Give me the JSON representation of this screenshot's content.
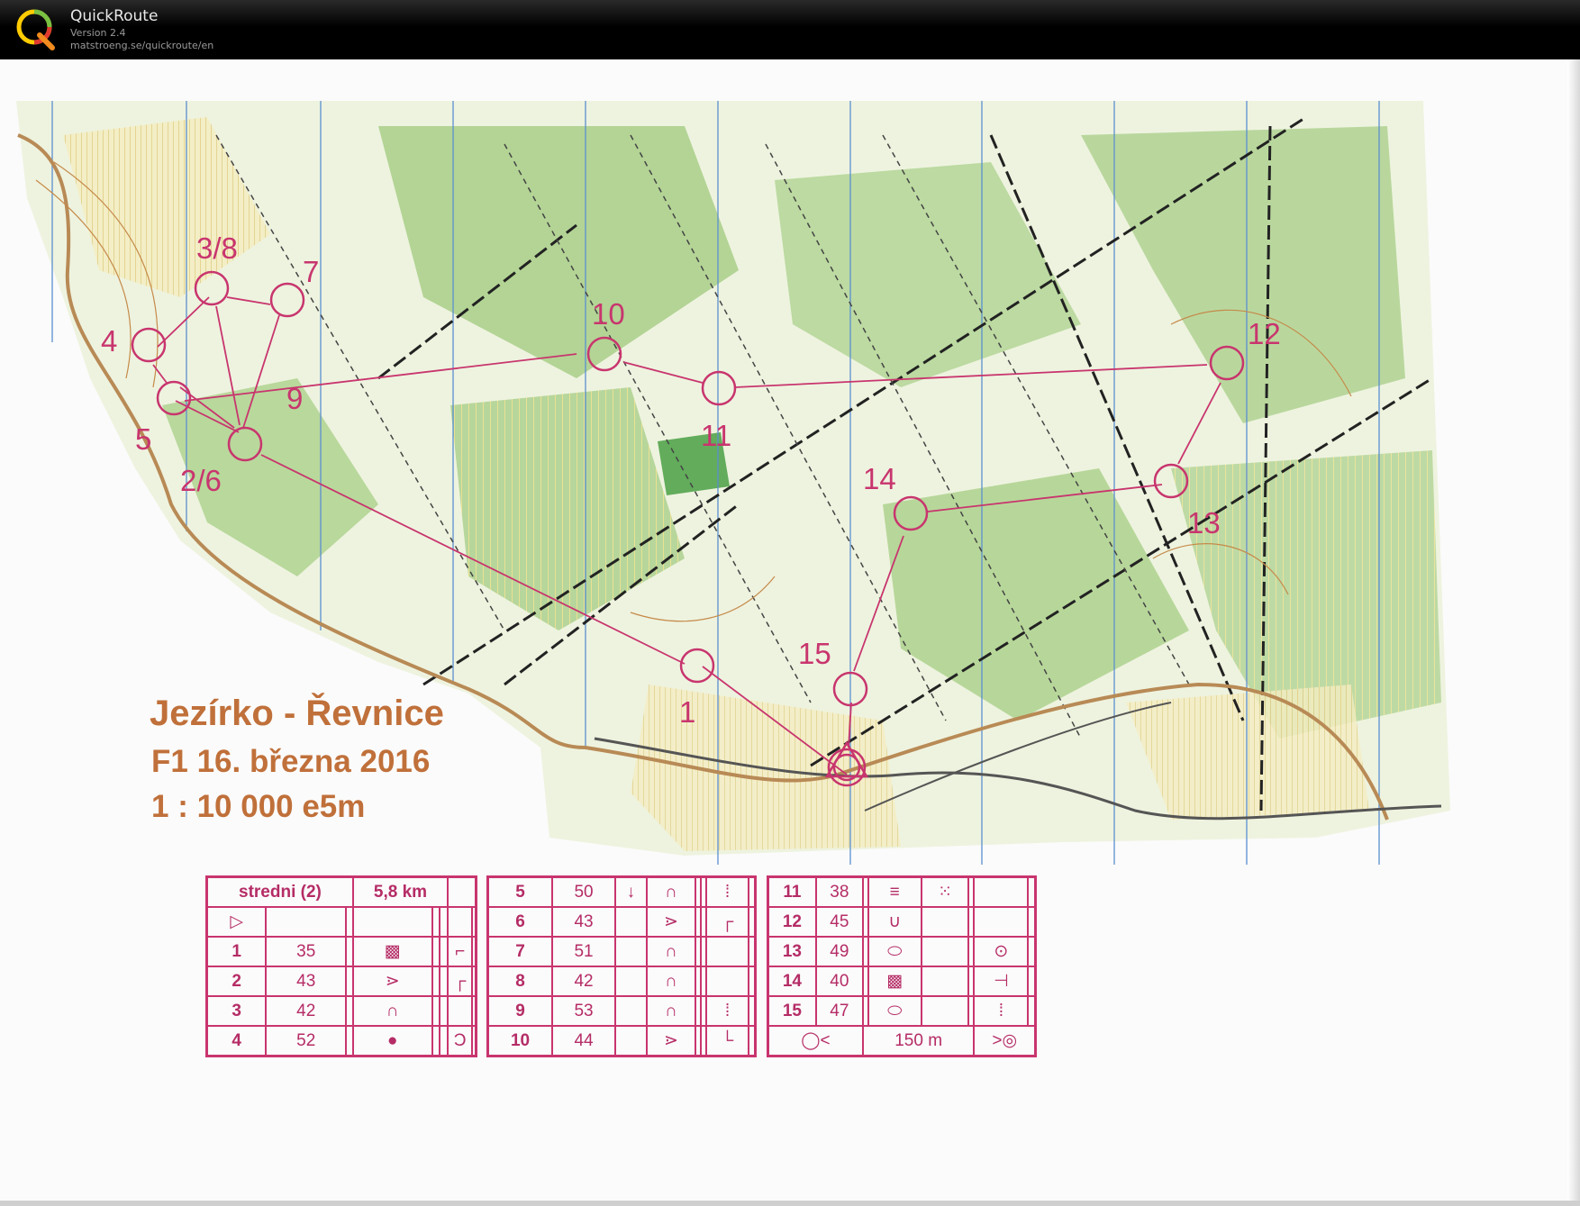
{
  "app": {
    "name": "QuickRoute",
    "version": "Version 2.4",
    "url": "matstroeng.se/quickroute/en"
  },
  "map": {
    "title": "Jezírko - Řevnice",
    "subtitle": "F1 16. března 2016",
    "scale": "1 : 10 000 e5m",
    "colors": {
      "course": "#c8356e",
      "forest": "#8fbf68",
      "open": "#f3d28a",
      "contour": "#c58a4a",
      "northline": "#5b8fd0",
      "track": "#222222"
    },
    "controls": [
      {
        "label": "3/8"
      },
      {
        "label": "7"
      },
      {
        "label": "4"
      },
      {
        "label": "10"
      },
      {
        "label": "12"
      },
      {
        "label": "9"
      },
      {
        "label": "11"
      },
      {
        "label": "5"
      },
      {
        "label": "2/6"
      },
      {
        "label": "14"
      },
      {
        "label": "13"
      },
      {
        "label": "15"
      },
      {
        "label": "1"
      }
    ]
  },
  "descriptions": {
    "header": {
      "course": "stredni (2)",
      "length": "5,8 km"
    },
    "left": [
      {
        "num": "1",
        "code": "35",
        "what": "thicket-symbol",
        "where": "corner-symbol"
      },
      {
        "num": "2",
        "code": "43",
        "what": "wedge-symbol",
        "where": "corner-symbol"
      },
      {
        "num": "3",
        "code": "42",
        "what": "knoll-symbol",
        "where": ""
      },
      {
        "num": "4",
        "code": "52",
        "what": "dot-symbol",
        "where": "hollow-symbol"
      }
    ],
    "middle": [
      {
        "num": "5",
        "code": "50",
        "d": "down-arrow",
        "what": "knoll-symbol",
        "where": "foot-symbol"
      },
      {
        "num": "6",
        "code": "43",
        "d": "",
        "what": "wedge-symbol",
        "where": "corner-symbol"
      },
      {
        "num": "7",
        "code": "51",
        "d": "",
        "what": "knoll-symbol",
        "where": ""
      },
      {
        "num": "8",
        "code": "42",
        "d": "",
        "what": "knoll-symbol",
        "where": ""
      },
      {
        "num": "9",
        "code": "53",
        "d": "",
        "what": "knoll-symbol",
        "where": "foot-symbol"
      },
      {
        "num": "10",
        "code": "44",
        "d": "",
        "what": "wedge-symbol",
        "where": "corner-symbol"
      }
    ],
    "right": [
      {
        "num": "11",
        "code": "38",
        "what": "marsh-symbol",
        "where": "dots-symbol"
      },
      {
        "num": "12",
        "code": "45",
        "what": "depression-symbol",
        "where": ""
      },
      {
        "num": "13",
        "code": "49",
        "what": "oval-symbol",
        "where": "circle-dot-symbol"
      },
      {
        "num": "14",
        "code": "40",
        "what": "thicket-symbol",
        "where": "end-symbol"
      },
      {
        "num": "15",
        "code": "47",
        "what": "oval-symbol",
        "where": "foot-symbol"
      }
    ],
    "finish": {
      "distance": "150 m"
    }
  }
}
